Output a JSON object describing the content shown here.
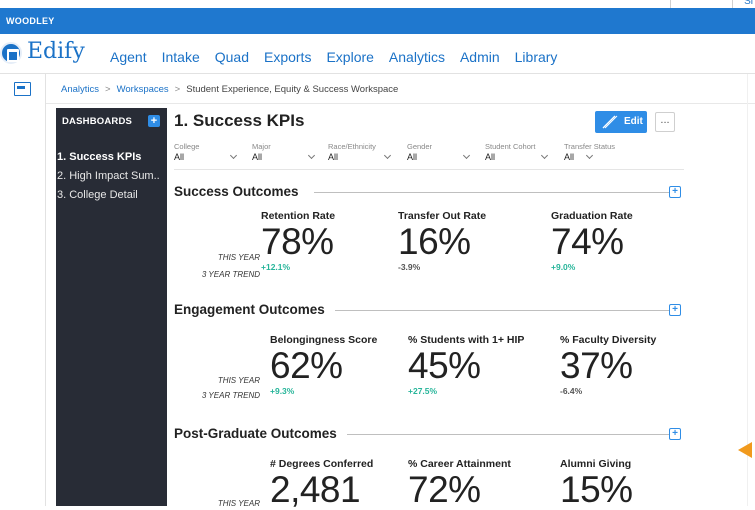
{
  "tenant": "WOODLEY",
  "corner_text": "Sl",
  "brand": "Edify",
  "nav": [
    "Agent",
    "Intake",
    "Quad",
    "Exports",
    "Explore",
    "Analytics",
    "Admin",
    "Library"
  ],
  "breadcrumb": {
    "items": [
      "Analytics",
      "Workspaces"
    ],
    "separator": ">",
    "current": "Student Experience, Equity & Success Workspace"
  },
  "sidebar": {
    "title": "DASHBOARDS",
    "add_label": "+",
    "items": [
      {
        "label": "1. Success KPIs",
        "active": true
      },
      {
        "label": "2. High Impact Sum..",
        "active": false
      },
      {
        "label": "3. College Detail",
        "active": false
      }
    ]
  },
  "page": {
    "title": "1. Success KPIs",
    "edit_label": "Edit",
    "more_label": "..."
  },
  "filters": [
    {
      "label": "College",
      "value": "All"
    },
    {
      "label": "Major",
      "value": "All"
    },
    {
      "label": "Race/Ethnicity",
      "value": "All"
    },
    {
      "label": "Gender",
      "value": "All"
    },
    {
      "label": "Student Cohort",
      "value": "All"
    },
    {
      "label": "Transfer Status",
      "value": "All"
    }
  ],
  "row_labels": {
    "this_year": "THIS YEAR",
    "trend": "3 YEAR TREND"
  },
  "sections": [
    {
      "title": "Success Outcomes",
      "metrics": [
        {
          "label": "Retention Rate",
          "value": "78%",
          "trend": "+12.1%",
          "trend_dir": "pos"
        },
        {
          "label": "Transfer Out Rate",
          "value": "16%",
          "trend": "-3.9%",
          "trend_dir": "neg"
        },
        {
          "label": "Graduation Rate",
          "value": "74%",
          "trend": "+9.0%",
          "trend_dir": "pos"
        }
      ]
    },
    {
      "title": "Engagement Outcomes",
      "metrics": [
        {
          "label": "Belongingness Score",
          "value": "62%",
          "trend": "+9.3%",
          "trend_dir": "pos"
        },
        {
          "label": "% Students with 1+  HIP",
          "value": "45%",
          "trend": "+27.5%",
          "trend_dir": "pos"
        },
        {
          "label": "% Faculty Diversity",
          "value": "37%",
          "trend": "-6.4%",
          "trend_dir": "neg"
        }
      ]
    },
    {
      "title": "Post-Graduate Outcomes",
      "metrics": [
        {
          "label": "# Degrees Conferred",
          "value": "2,481",
          "trend": "",
          "trend_dir": "pos"
        },
        {
          "label": "% Career Attainment",
          "value": "72%",
          "trend": "",
          "trend_dir": "pos"
        },
        {
          "label": "Alumni Giving",
          "value": "15%",
          "trend": "",
          "trend_dir": "pos"
        }
      ]
    }
  ],
  "colors": {
    "brand_blue": "#1f78cf",
    "sidebar_bg": "#282c36",
    "positive": "#27b59a",
    "negative": "#555555",
    "flag": "#f19a1d"
  },
  "icons": [
    "logo-icon",
    "dashboard-rail-icon",
    "add-dashboard-icon",
    "pencil-icon",
    "expand-section-icon",
    "chevron-down-icon",
    "collapse-flag-icon"
  ]
}
